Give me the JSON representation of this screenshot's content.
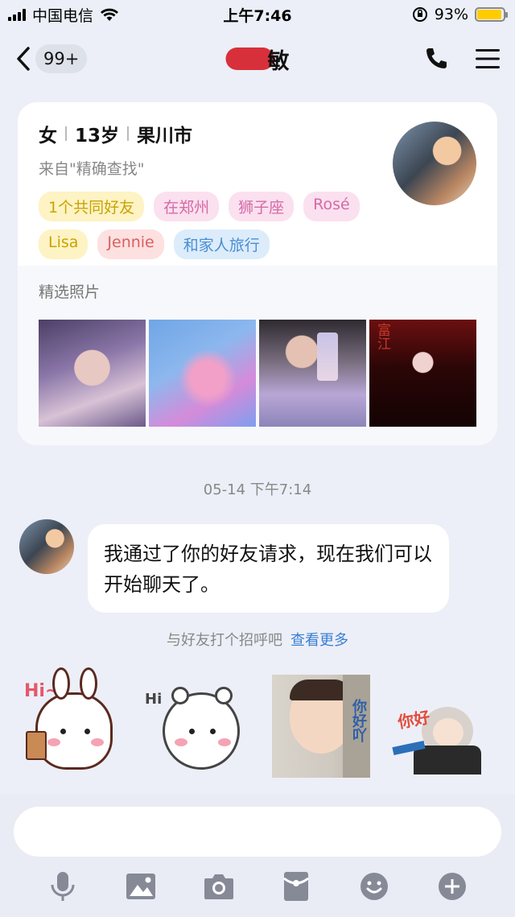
{
  "status_bar": {
    "carrier": "中国电信",
    "time": "上午7:46",
    "battery_percent": "93%",
    "battery_level": 0.93
  },
  "nav": {
    "unread_count": "99+",
    "contact_name_visible": "敏",
    "back_icon": "chevron-left-icon",
    "call_icon": "phone-icon",
    "menu_icon": "hamburger-menu-icon"
  },
  "profile": {
    "gender": "女",
    "age": "13岁",
    "city": "果川市",
    "source": "来自\"精确查找\"",
    "tags": [
      {
        "label": "1个共同好友",
        "color": "yellow"
      },
      {
        "label": "在郑州",
        "color": "pink"
      },
      {
        "label": "狮子座",
        "color": "pink"
      },
      {
        "label": "Rosé",
        "color": "pink"
      },
      {
        "label": "Lisa",
        "color": "yellow"
      },
      {
        "label": "Jennie",
        "color": "red"
      },
      {
        "label": "和家人旅行",
        "color": "blue"
      }
    ],
    "photos_label": "精选照片",
    "photo_4_caption": "富江"
  },
  "chat": {
    "timestamp": "05-14 下午7:14",
    "message": "我通过了你的好友请求，现在我们可以开始聊天了。",
    "hint": "与好友打个招呼吧",
    "more_link": "查看更多"
  },
  "stickers": [
    {
      "name": "bunny-hi",
      "text": "Hi~"
    },
    {
      "name": "bear-hi",
      "text": "Hi"
    },
    {
      "name": "baby-peek",
      "text": "你好吖"
    },
    {
      "name": "anime-girl",
      "text": "你好"
    }
  ],
  "input": {
    "placeholder": ""
  },
  "toolbar": [
    "microphone-icon",
    "image-icon",
    "camera-icon",
    "red-packet-icon",
    "emoji-icon",
    "plus-icon"
  ],
  "colors": {
    "background": "#eceff7",
    "link": "#3a7fd5",
    "battery": "#ffcc00"
  }
}
